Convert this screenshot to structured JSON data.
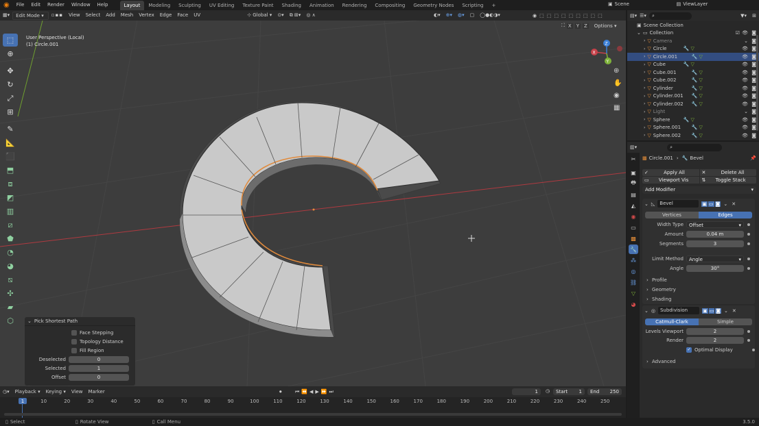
{
  "topbar": {
    "menus": [
      "File",
      "Edit",
      "Render",
      "Window",
      "Help"
    ],
    "workspaces": [
      "Layout",
      "Modeling",
      "Sculpting",
      "UV Editing",
      "Texture Paint",
      "Shading",
      "Animation",
      "Rendering",
      "Compositing",
      "Geometry Nodes",
      "Scripting"
    ],
    "active_workspace": "Layout",
    "add_tab": "+",
    "scene": "Scene",
    "view_layer": "ViewLayer"
  },
  "viewport_header": {
    "mode": "Edit Mode",
    "menus": [
      "View",
      "Select",
      "Add",
      "Mesh",
      "Vertex",
      "Edge",
      "Face",
      "UV"
    ],
    "transform_orientation": "Global",
    "axes": [
      "X",
      "Y",
      "Z"
    ],
    "options": "Options"
  },
  "viewport": {
    "perspective": "User Perspective (Local)",
    "object": "(1) Circle.001",
    "gizmo": {
      "x": "X",
      "y": "Y",
      "z": "Z"
    }
  },
  "operator_panel": {
    "title": "Pick Shortest Path",
    "checks": [
      "Face Stepping",
      "Topology Distance",
      "Fill Region"
    ],
    "fields": [
      {
        "label": "Deselected",
        "value": "0"
      },
      {
        "label": "Selected",
        "value": "1"
      },
      {
        "label": "Offset",
        "value": "0"
      }
    ]
  },
  "timeline": {
    "menus": [
      "Playback",
      "Keying",
      "View",
      "Marker"
    ],
    "current_frame": "1",
    "start_label": "Start",
    "start": "1",
    "end_label": "End",
    "end": "250",
    "ticks": [
      "1",
      "10",
      "20",
      "30",
      "40",
      "50",
      "60",
      "70",
      "80",
      "90",
      "100",
      "110",
      "120",
      "130",
      "140",
      "150",
      "160",
      "170",
      "180",
      "190",
      "200",
      "210",
      "220",
      "230",
      "240",
      "250"
    ]
  },
  "statusbar": {
    "select": "Select",
    "rotate": "Rotate View",
    "menu": "Call Menu",
    "version": "3.5.0"
  },
  "outliner": {
    "scene_collection": "Scene Collection",
    "collection": "Collection",
    "items": [
      {
        "name": "Camera",
        "dim": true,
        "sel": false
      },
      {
        "name": "Circle",
        "dim": false,
        "sel": false
      },
      {
        "name": "Circle.001",
        "dim": false,
        "sel": true
      },
      {
        "name": "Cube",
        "dim": false,
        "sel": false
      },
      {
        "name": "Cube.001",
        "dim": false,
        "sel": false
      },
      {
        "name": "Cube.002",
        "dim": false,
        "sel": false
      },
      {
        "name": "Cylinder",
        "dim": false,
        "sel": false
      },
      {
        "name": "Cylinder.001",
        "dim": false,
        "sel": false
      },
      {
        "name": "Cylinder.002",
        "dim": false,
        "sel": false
      },
      {
        "name": "Light",
        "dim": true,
        "sel": false
      },
      {
        "name": "Sphere",
        "dim": false,
        "sel": false
      },
      {
        "name": "Sphere.001",
        "dim": false,
        "sel": false
      },
      {
        "name": "Sphere.002",
        "dim": false,
        "sel": false
      }
    ]
  },
  "properties": {
    "breadcrumb_object": "Circle.001",
    "breadcrumb_modifier": "Bevel",
    "apply_all": "Apply All",
    "delete_all": "Delete All",
    "viewport_vis": "Viewport Vis",
    "toggle_stack": "Toggle Stack",
    "add_modifier": "Add Modifier",
    "bevel": {
      "name": "Bevel",
      "affect": [
        "Vertices",
        "Edges"
      ],
      "affect_active": "Edges",
      "width_type_label": "Width Type",
      "width_type": "Offset",
      "amount_label": "Amount",
      "amount": "0.04 m",
      "segments_label": "Segments",
      "segments": "3",
      "limit_method_label": "Limit Method",
      "limit_method": "Angle",
      "angle_label": "Angle",
      "angle": "30°",
      "sections": [
        "Profile",
        "Geometry",
        "Shading"
      ]
    },
    "subdivision": {
      "name": "Subdivision",
      "types": [
        "Catmull-Clark",
        "Simple"
      ],
      "type_active": "Catmull-Clark",
      "levels_viewport_label": "Levels Viewport",
      "levels_viewport": "2",
      "render_label": "Render",
      "render": "2",
      "optimal_display": "Optimal Display",
      "advanced": "Advanced"
    }
  },
  "colors": {
    "accent": "#4772b3",
    "selected_edge": "#e08a3c",
    "x_axis": "#c8424a",
    "y_axis": "#7fb33a",
    "z_axis": "#3b7fd6"
  }
}
